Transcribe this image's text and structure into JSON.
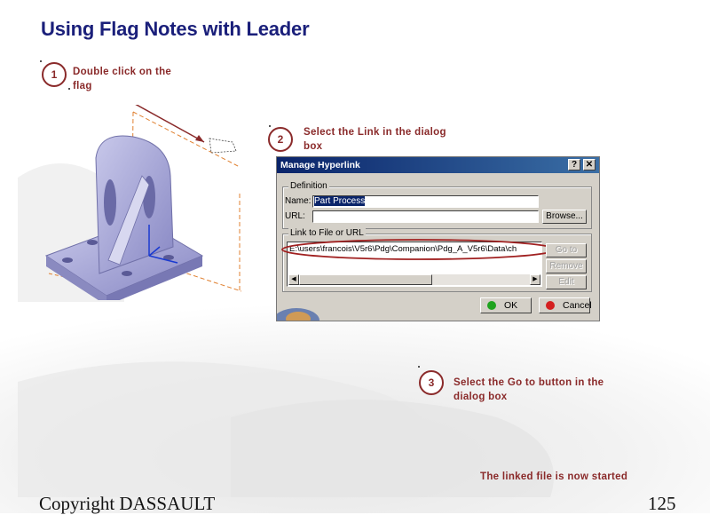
{
  "slide": {
    "title": "Using Flag Notes with Leader",
    "footer_left": "Copyright DASSAULT",
    "page_number": "125",
    "linked_note": "The linked file is now started"
  },
  "steps": [
    {
      "number": "1",
      "text_line1": "Double click on the",
      "text_line2": "flag"
    },
    {
      "number": "2",
      "text_line1": "Select the Link in the dialog",
      "text_line2": "box"
    },
    {
      "number": "3",
      "text_line1": "Select the Go to button in the",
      "text_line2": "dialog box"
    }
  ],
  "dialog": {
    "title": "Manage Hyperlink",
    "help_label": "?",
    "close_label": "✕",
    "definition_legend": "Definition",
    "name_label": "Name:",
    "name_value": "Part Process",
    "url_label": "URL:",
    "url_value": "",
    "browse_label": "Browse...",
    "link_legend": "Link to File or URL",
    "link_item": "E:\\users\\francois\\V5r6\\Pdg\\Companion\\Pdg_A_V5r6\\Data\\ch",
    "goto_label": "Go to",
    "remove_label": "Remove",
    "edit_label": "Edit",
    "ok_label": "OK",
    "cancel_label": "Cancel"
  },
  "colors": {
    "title": "#1a1f7a",
    "step_text": "#8a2a2a",
    "part": "#a8a8d8",
    "ok_dot": "#1fa31f",
    "cancel_dot": "#d42020"
  }
}
